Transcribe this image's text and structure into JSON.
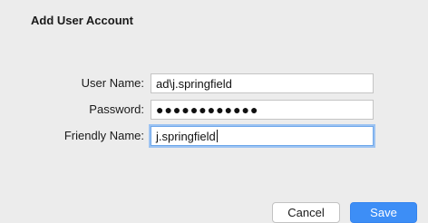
{
  "dialog": {
    "title": "Add User Account"
  },
  "form": {
    "user_name": {
      "label": "User Name:",
      "value": "ad\\j.springfield"
    },
    "password": {
      "label": "Password:",
      "value": "●●●●●●●●●●●●"
    },
    "friendly_name": {
      "label": "Friendly Name:",
      "value": "j.springfield"
    }
  },
  "buttons": {
    "cancel_label": "Cancel",
    "save_label": "Save"
  },
  "colors": {
    "accent": "#3d8ef6",
    "focus_ring": "#9cc3f2",
    "background": "#ececec"
  }
}
